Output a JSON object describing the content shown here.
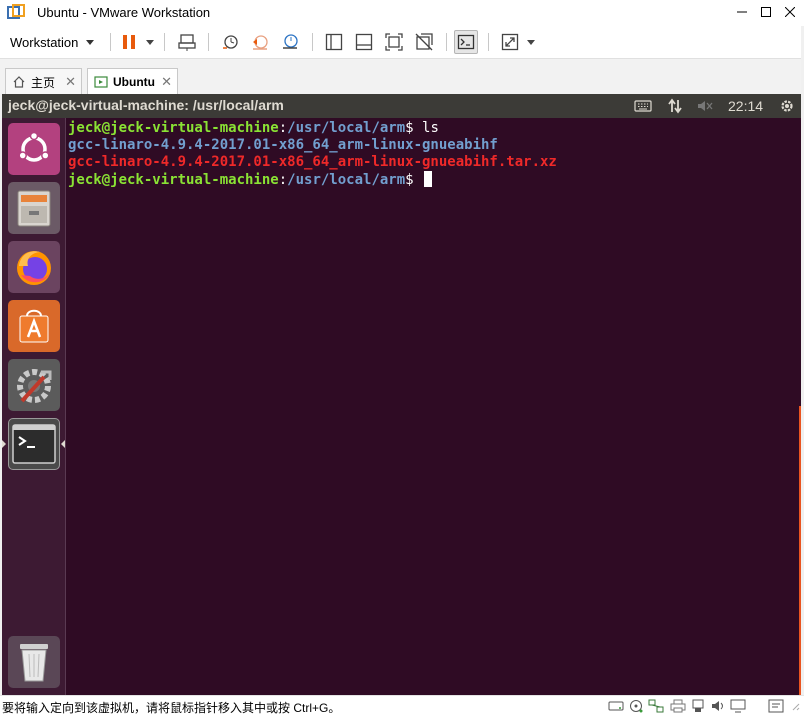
{
  "window": {
    "title": "Ubuntu - VMware Workstation",
    "icon": "vmware-logo-icon"
  },
  "toolbar": {
    "workstation_label": "Workstation",
    "buttons": [
      "pause-icon",
      "send-ctrl-alt-del-icon",
      "snapshot-icon",
      "revert-snapshot-icon",
      "snapshot-manager-icon",
      "show-library-icon",
      "thumbnail-bar-icon",
      "full-screen-icon",
      "unity-icon",
      "console-view-icon",
      "stretch-guest-icon"
    ]
  },
  "tabs": [
    {
      "label": "主页",
      "icon": "home-icon",
      "close": "✕"
    },
    {
      "label": "Ubuntu",
      "icon": "vm-tab-icon",
      "close": "✕"
    }
  ],
  "guest": {
    "topbar_title": "jeck@jeck-virtual-machine: /usr/local/arm",
    "clock": "22:14",
    "tray_icons": [
      "keyboard-icon",
      "network-icon",
      "volume-muted-icon",
      "settings-gear-icon"
    ],
    "launcher": [
      "ubuntu-dash-icon",
      "files-icon",
      "firefox-icon",
      "software-center-icon",
      "system-settings-icon",
      "terminal-icon",
      "trash-icon"
    ]
  },
  "terminal": {
    "lines": [
      {
        "user": "jeck@jeck-virtual-machine",
        "sep": ":",
        "path": "/usr/local/arm",
        "prompt": "$ ",
        "cmd": "ls"
      },
      {
        "dir": "gcc-linaro-4.9.4-2017.01-x86_64_arm-linux-gnueabihf"
      },
      {
        "archive": "gcc-linaro-4.9.4-2017.01-x86_64_arm-linux-gnueabihf.tar.xz"
      },
      {
        "user": "jeck@jeck-virtual-machine",
        "sep": ":",
        "path": "/usr/local/arm",
        "prompt": "$ ",
        "cmd": ""
      }
    ]
  },
  "statusbar": {
    "text": "要将输入定向到该虚拟机，请将鼠标指针移入其中或按 Ctrl+G。",
    "icons": [
      "hard-disk-icon",
      "network-adapter-icon",
      "usb-icon",
      "printer-icon",
      "sound-card-icon",
      "display-icon",
      "message-icon"
    ]
  },
  "colors": {
    "terminal_bg": "#2f0b24",
    "prompt_user": "#8ae234",
    "prompt_path": "#729fcf",
    "directory": "#729fcf",
    "archive": "#ef2929",
    "launcher_bg": "#3d1a33",
    "ubuntu_orange": "#e95420"
  }
}
